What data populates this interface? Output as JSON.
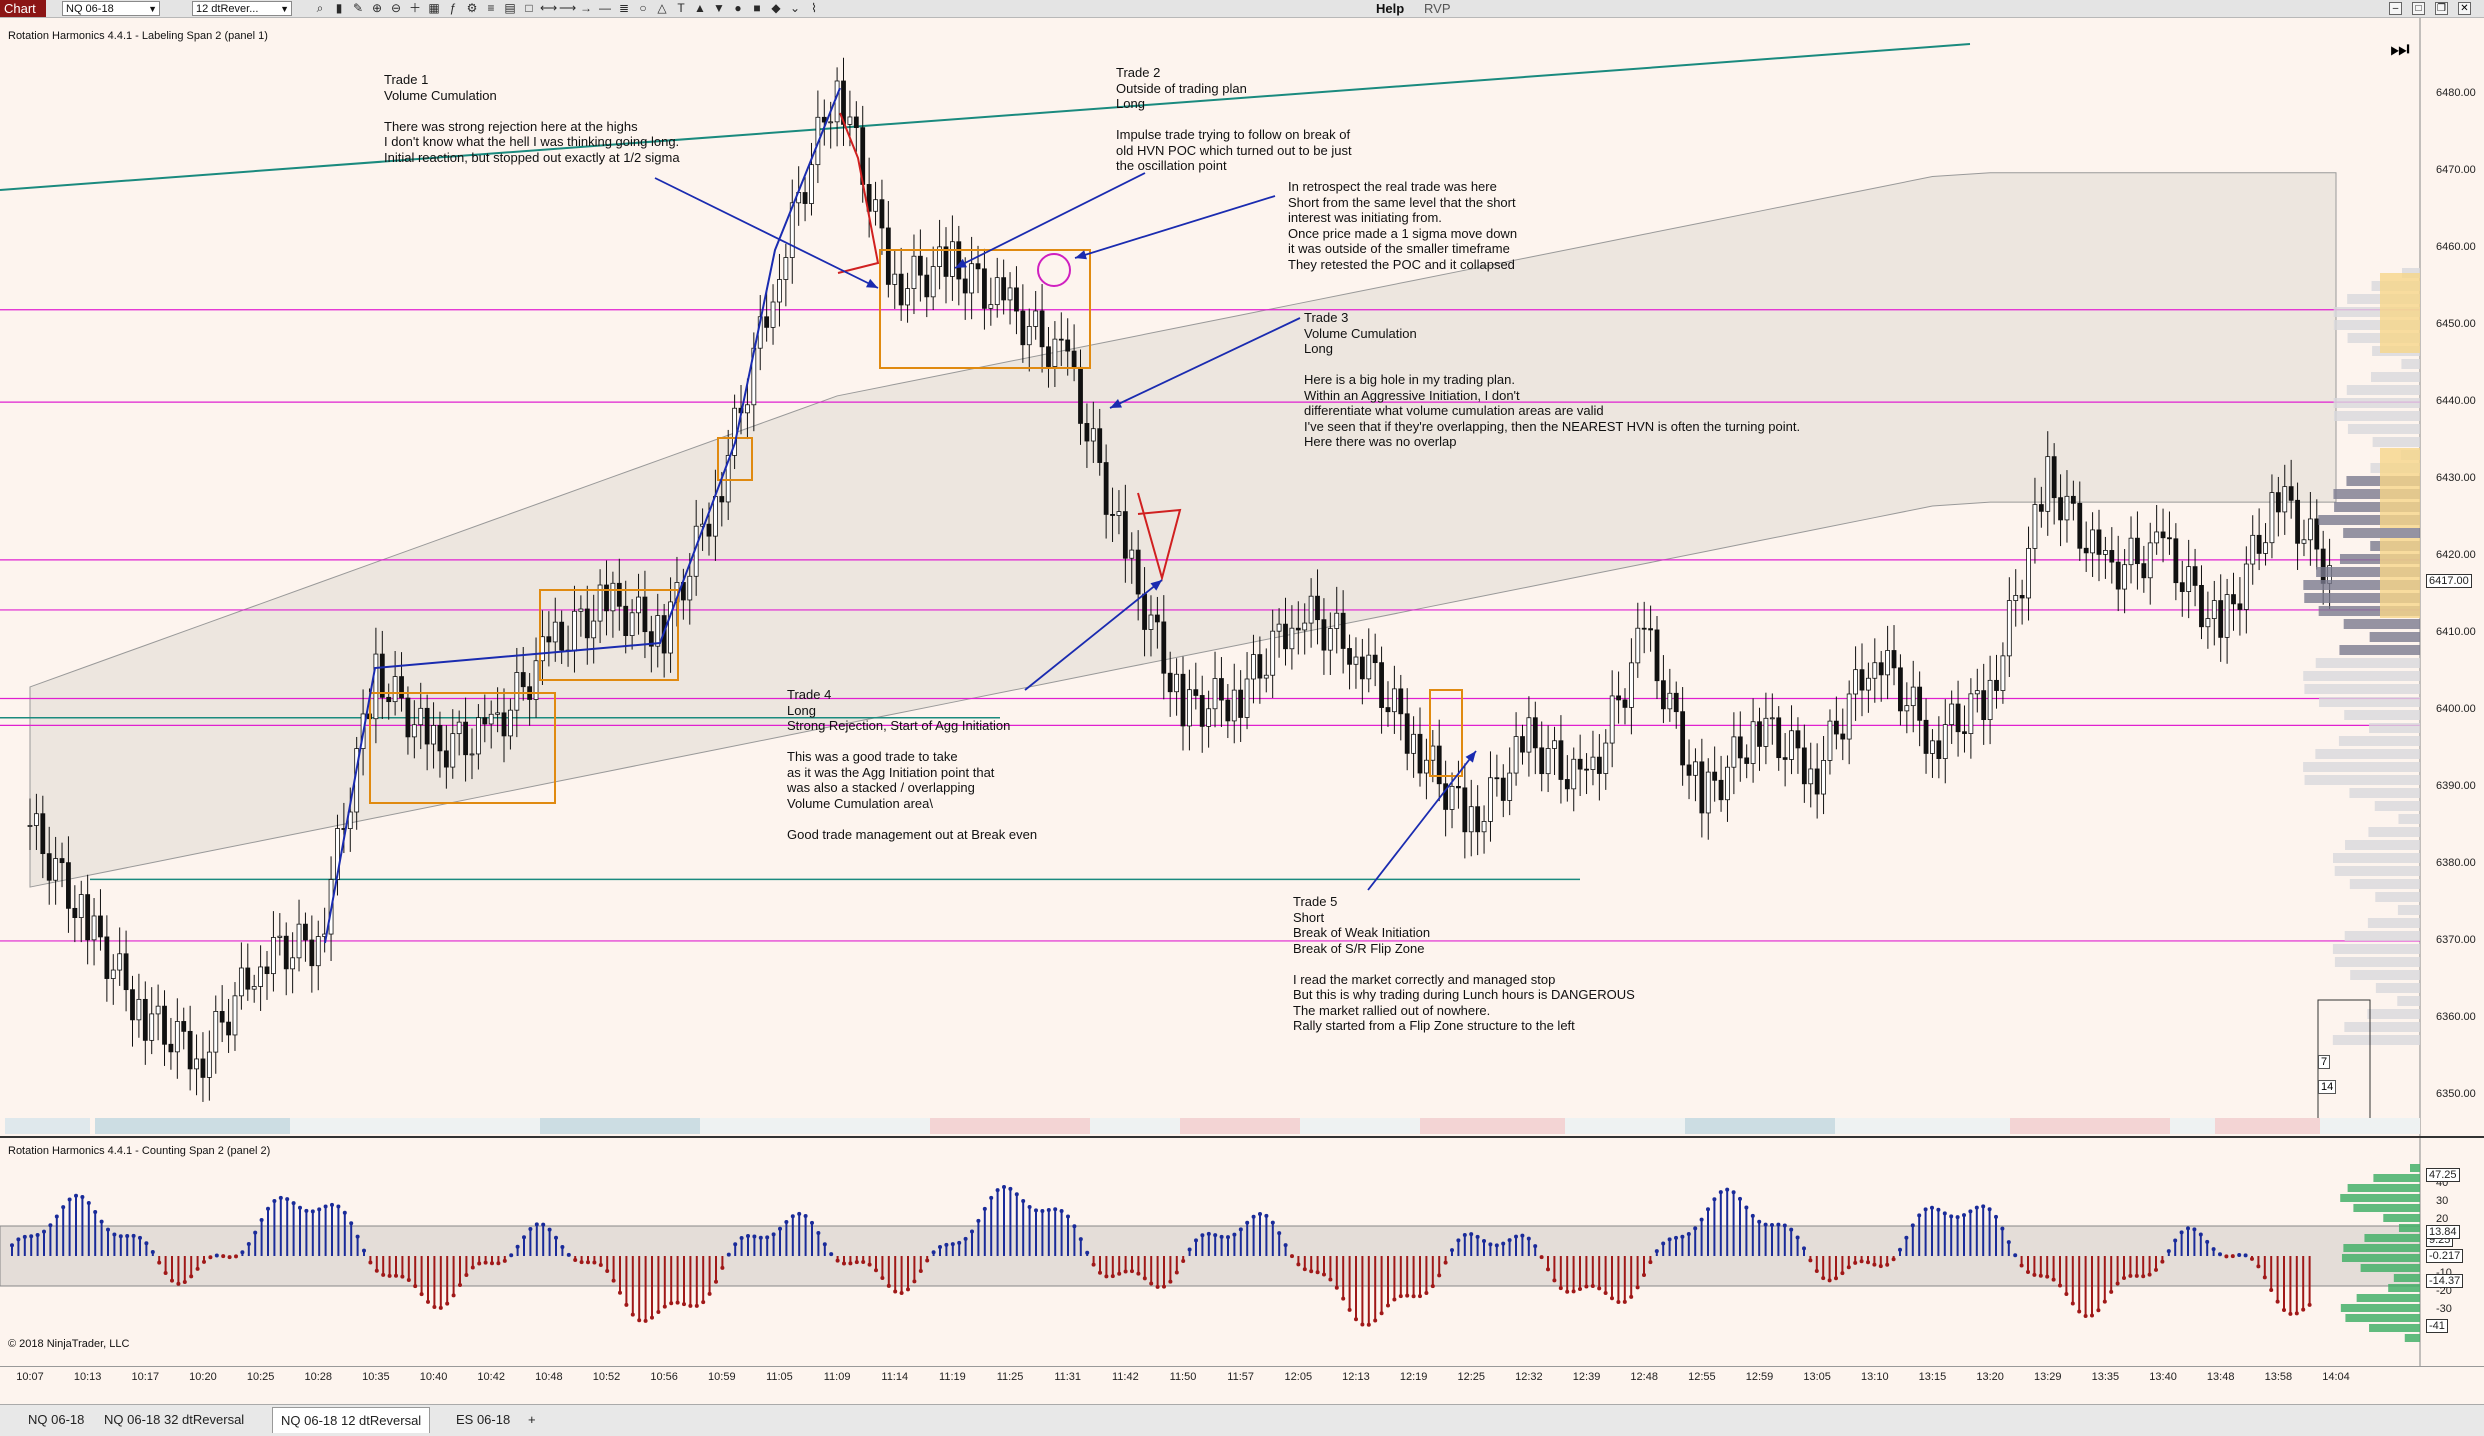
{
  "toolbar": {
    "app_label": "Chart",
    "instrument": "NQ 06-18",
    "bar_type": "12 dtRever...",
    "help": "Help",
    "rvp": "RVP",
    "icons": [
      "search-icon",
      "bar-chart-icon",
      "pencil-icon",
      "zoom-in-icon",
      "zoom-out-icon",
      "crosshair-icon",
      "data-box-icon",
      "indicator-icon",
      "strategy-icon",
      "properties-icon",
      "grid-icon",
      "window-icon",
      "ruler-icon",
      "arrow-line-icon",
      "ray-icon",
      "horizontal-line-icon",
      "fib-icon",
      "ellipse-icon",
      "triangle-icon",
      "text-icon",
      "arrow-up-icon",
      "arrow-down-icon",
      "dot-icon",
      "square-icon",
      "diamond-icon",
      "chevron-icon",
      "brush-icon"
    ]
  },
  "panel1": {
    "label": "Rotation Harmonics 4.4.1 - Labeling Span 2  (panel 1)",
    "price_ticks": [
      "6480.00",
      "6470.00",
      "6460.00",
      "6450.00",
      "6440.00",
      "6430.00",
      "6420.00",
      "6410.00",
      "6400.00",
      "6390.00",
      "6380.00",
      "6370.00",
      "6360.00",
      "6350.00"
    ],
    "last_price": "6417.00",
    "annotations": {
      "trade1": "Trade 1\nVolume Cumulation\n\nThere was strong rejection here at the highs\nI don't know what the hell I was thinking going long.\nInitial reaction, but stopped out exactly at 1/2 sigma",
      "trade2": "Trade 2\nOutside of trading plan\nLong\n\nImpulse trade trying to follow on break of\nold HVN POC which turned out to be just\nthe oscillation point",
      "retro": "In retrospect the real trade was here\nShort from the same level that the short\ninterest was initiating from.\nOnce price made a 1 sigma move down\nit was outside of the smaller timeframe\nThey retested the POC and it collapsed",
      "trade3": "Trade 3\nVolume Cumulation\nLong\n\nHere is a big hole in my trading plan.\nWithin an Aggressive Initiation, I don't\ndifferentiate what volume cumulation areas are valid\nI've seen that if they're overlapping, then the NEAREST HVN is often the turning point.\nHere there was no overlap",
      "trade4": "Trade 4\nLong\nStrong Rejection, Start of Agg Initiation\n\nThis was a good trade to take\nas it was the Agg Initiation point that\nwas also a stacked / overlapping\nVolume Cumulation area\\\n\nGood trade management out at Break even",
      "trade5": "Trade 5\nShort\nBreak of Weak Initiation\nBreak of S/R Flip Zone\n\nI read the market correctly and managed stop\nBut this is why trading during Lunch hours is DANGEROUS\nThe market rallied out of nowhere.\nRally started from a Flip Zone structure to the left"
    },
    "box_count_top": "7",
    "box_count_bottom": "14"
  },
  "panel2": {
    "label": "Rotation Harmonics 4.4.1 - Counting Span 2  (panel 2)",
    "copyright": "© 2018 NinjaTrader, LLC",
    "osc_ticks": [
      "40",
      "30",
      "20",
      "10",
      "-10",
      "-20",
      "-30"
    ],
    "badges": [
      "47.25",
      "9.25",
      "-0.217",
      "-14.37",
      "-41",
      "13.84"
    ]
  },
  "time_axis": [
    "10:07",
    "10:13",
    "10:17",
    "10:20",
    "10:25",
    "10:28",
    "10:35",
    "10:40",
    "10:42",
    "10:48",
    "10:52",
    "10:56",
    "10:59",
    "11:05",
    "11:09",
    "11:14",
    "11:19",
    "11:25",
    "11:31",
    "11:42",
    "11:50",
    "11:57",
    "12:05",
    "12:13",
    "12:19",
    "12:25",
    "12:32",
    "12:39",
    "12:48",
    "12:55",
    "12:59",
    "13:05",
    "13:10",
    "13:15",
    "13:20",
    "13:29",
    "13:35",
    "13:40",
    "13:48",
    "13:58",
    "14:04"
  ],
  "tabs": [
    "NQ 06-18",
    "NQ 06-18 32 dtReversal",
    "NQ 06-18 12 dtReversal",
    "ES 06-18",
    "+"
  ],
  "chart_data": {
    "type": "candlestick",
    "instrument": "NQ 06-18",
    "y_range": [
      6347,
      6486
    ],
    "price_series_approx": [
      [
        "10:07",
        6385
      ],
      [
        "10:13",
        6372
      ],
      [
        "10:17",
        6360
      ],
      [
        "10:20",
        6355
      ],
      [
        "10:25",
        6368
      ],
      [
        "10:28",
        6370
      ],
      [
        "10:35",
        6405
      ],
      [
        "10:40",
        6395
      ],
      [
        "10:42",
        6397
      ],
      [
        "10:48",
        6408
      ],
      [
        "10:52",
        6414
      ],
      [
        "10:56",
        6410
      ],
      [
        "10:59",
        6430
      ],
      [
        "11:05",
        6458
      ],
      [
        "11:09",
        6482
      ],
      [
        "11:14",
        6455
      ],
      [
        "11:19",
        6458
      ],
      [
        "11:25",
        6452
      ],
      [
        "11:31",
        6445
      ],
      [
        "11:42",
        6420
      ],
      [
        "11:50",
        6400
      ],
      [
        "11:57",
        6402
      ],
      [
        "12:05",
        6413
      ],
      [
        "12:13",
        6408
      ],
      [
        "12:19",
        6396
      ],
      [
        "12:25",
        6385
      ],
      [
        "12:32",
        6396
      ],
      [
        "12:39",
        6390
      ],
      [
        "12:48",
        6410
      ],
      [
        "12:55",
        6388
      ],
      [
        "12:59",
        6398
      ],
      [
        "13:05",
        6392
      ],
      [
        "13:10",
        6408
      ],
      [
        "13:15",
        6396
      ],
      [
        "13:20",
        6402
      ],
      [
        "13:29",
        6430
      ],
      [
        "13:35",
        6418
      ],
      [
        "13:40",
        6421
      ],
      [
        "13:48",
        6410
      ],
      [
        "13:58",
        6428
      ],
      [
        "14:04",
        6417
      ]
    ],
    "key_levels": [
      6452,
      6440,
      6419.5,
      6413,
      6401.5,
      6398,
      6370
    ],
    "oscillator_range": [
      -41,
      47.25
    ]
  }
}
